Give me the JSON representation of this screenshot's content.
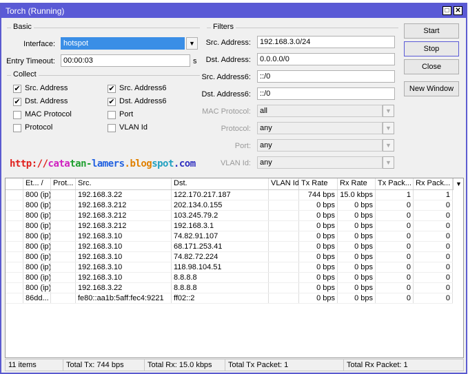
{
  "window": {
    "title": "Torch (Running)",
    "maximize": "□",
    "close": "✕"
  },
  "basic": {
    "legend": "Basic",
    "interface_label": "Interface:",
    "interface_value": "hotspot",
    "timeout_label": "Entry Timeout:",
    "timeout_value": "00:00:03",
    "timeout_unit": "s"
  },
  "collect": {
    "legend": "Collect",
    "items": [
      {
        "label": "Src. Address",
        "checked": true
      },
      {
        "label": "Src. Address6",
        "checked": true
      },
      {
        "label": "Dst. Address",
        "checked": true
      },
      {
        "label": "Dst. Address6",
        "checked": true
      },
      {
        "label": "MAC Protocol",
        "checked": false
      },
      {
        "label": "Port",
        "checked": false
      },
      {
        "label": "Protocol",
        "checked": false
      },
      {
        "label": "VLAN Id",
        "checked": false
      }
    ]
  },
  "filters": {
    "legend": "Filters",
    "fields": [
      {
        "label": "Src. Address:",
        "value": "192.168.3.0/24"
      },
      {
        "label": "Dst. Address:",
        "value": "0.0.0.0/0"
      },
      {
        "label": "Src. Address6:",
        "value": "::/0"
      },
      {
        "label": "Dst. Address6:",
        "value": "::/0"
      },
      {
        "label": "MAC Protocol:",
        "value": "all"
      },
      {
        "label": "Protocol:",
        "value": "any"
      },
      {
        "label": "Port:",
        "value": "any"
      },
      {
        "label": "VLAN Id:",
        "value": "any"
      }
    ]
  },
  "watermark": "http://catatan-lamers.blogspot.com",
  "buttons": {
    "start": "Start",
    "stop": "Stop",
    "close": "Close",
    "new_window": "New Window"
  },
  "table": {
    "columns": [
      "Et... /",
      "Prot...",
      "Src.",
      "Dst.",
      "VLAN Id",
      "Tx Rate",
      "Rx Rate",
      "Tx Pack...",
      "Rx Pack..."
    ],
    "rows": [
      [
        "800 (ip)",
        "",
        "192.168.3.22",
        "122.170.217.187",
        "",
        "744 bps",
        "15.0 kbps",
        "1",
        "1"
      ],
      [
        "800 (ip)",
        "",
        "192.168.3.212",
        "202.134.0.155",
        "",
        "0 bps",
        "0 bps",
        "0",
        "0"
      ],
      [
        "800 (ip)",
        "",
        "192.168.3.212",
        "103.245.79.2",
        "",
        "0 bps",
        "0 bps",
        "0",
        "0"
      ],
      [
        "800 (ip)",
        "",
        "192.168.3.212",
        "192.168.3.1",
        "",
        "0 bps",
        "0 bps",
        "0",
        "0"
      ],
      [
        "800 (ip)",
        "",
        "192.168.3.10",
        "74.82.91.107",
        "",
        "0 bps",
        "0 bps",
        "0",
        "0"
      ],
      [
        "800 (ip)",
        "",
        "192.168.3.10",
        "68.171.253.41",
        "",
        "0 bps",
        "0 bps",
        "0",
        "0"
      ],
      [
        "800 (ip)",
        "",
        "192.168.3.10",
        "74.82.72.224",
        "",
        "0 bps",
        "0 bps",
        "0",
        "0"
      ],
      [
        "800 (ip)",
        "",
        "192.168.3.10",
        "118.98.104.51",
        "",
        "0 bps",
        "0 bps",
        "0",
        "0"
      ],
      [
        "800 (ip)",
        "",
        "192.168.3.10",
        "8.8.8.8",
        "",
        "0 bps",
        "0 bps",
        "0",
        "0"
      ],
      [
        "800 (ip)",
        "",
        "192.168.3.22",
        "8.8.8.8",
        "",
        "0 bps",
        "0 bps",
        "0",
        "0"
      ],
      [
        "86dd...",
        "",
        "fe80::aa1b:5aff:fec4:9221",
        "ff02::2",
        "",
        "0 bps",
        "0 bps",
        "0",
        "0"
      ]
    ]
  },
  "status": {
    "items": "11 items",
    "total_tx": "Total Tx: 744 bps",
    "total_rx": "Total Rx: 15.0 kbps",
    "total_tx_packet": "Total Tx Packet: 1",
    "total_rx_packet": "Total Rx Packet: 1"
  }
}
